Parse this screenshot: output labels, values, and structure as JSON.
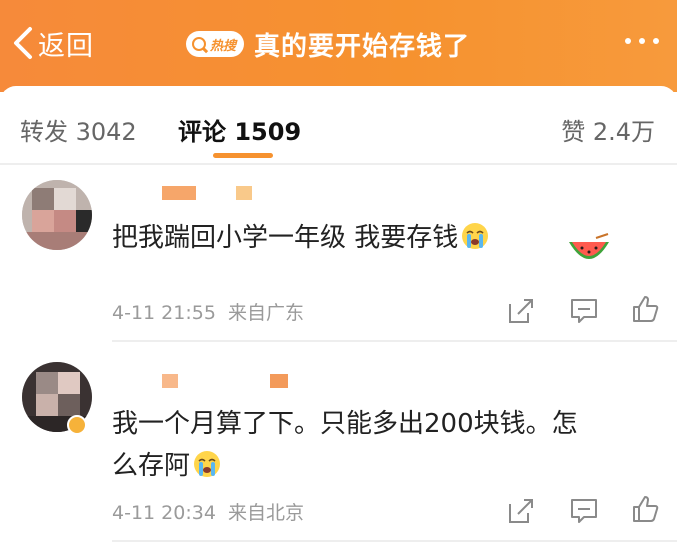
{
  "header": {
    "back_label": "返回",
    "hot_badge": "热搜",
    "title": "真的要开始存钱了",
    "background_color": "#f6922f"
  },
  "tabs": {
    "repost": "转发 3042",
    "comments": "评论 1509",
    "likes": "赞 2.4万",
    "accent_color": "#f6922f"
  },
  "comments": [
    {
      "text": "把我踹回小学一年级 我要存钱",
      "time": "4-11 21:55",
      "source": "来自广东",
      "emoji": "crying-face",
      "sticker": "watermelon-icon"
    },
    {
      "text_line1": "我一个月算了下。只能多出200块钱。怎",
      "text_line2": "么存阿",
      "time": "4-11 20:34",
      "source": "来自北京",
      "emoji": "crying-face"
    }
  ],
  "icons": [
    "back-arrow-icon",
    "search-icon",
    "more-icon",
    "share-icon",
    "comment-icon",
    "like-icon"
  ]
}
